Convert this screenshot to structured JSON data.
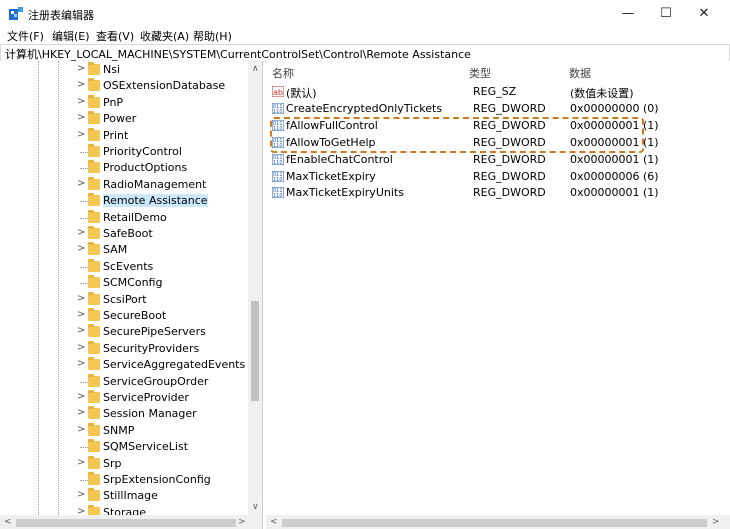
{
  "window": {
    "title": "注册表编辑器",
    "minimize_glyph": "—",
    "maximize_glyph": "☐",
    "close_glyph": "✕"
  },
  "menu": [
    "文件(F)",
    "编辑(E)",
    "查看(V)",
    "收藏夹(A)",
    "帮助(H)"
  ],
  "address": "计算机\\HKEY_LOCAL_MACHINE\\SYSTEM\\CurrentControlSet\\Control\\Remote Assistance",
  "tree": [
    {
      "label": "Nsi",
      "expandable": true
    },
    {
      "label": "OSExtensionDatabase",
      "expandable": true
    },
    {
      "label": "PnP",
      "expandable": true
    },
    {
      "label": "Power",
      "expandable": true
    },
    {
      "label": "Print",
      "expandable": true
    },
    {
      "label": "PriorityControl",
      "expandable": false
    },
    {
      "label": "ProductOptions",
      "expandable": false
    },
    {
      "label": "RadioManagement",
      "expandable": true
    },
    {
      "label": "Remote Assistance",
      "expandable": false,
      "selected": true
    },
    {
      "label": "RetailDemo",
      "expandable": false
    },
    {
      "label": "SafeBoot",
      "expandable": true
    },
    {
      "label": "SAM",
      "expandable": true
    },
    {
      "label": "ScEvents",
      "expandable": false
    },
    {
      "label": "SCMConfig",
      "expandable": false
    },
    {
      "label": "ScsiPort",
      "expandable": true
    },
    {
      "label": "SecureBoot",
      "expandable": true
    },
    {
      "label": "SecurePipeServers",
      "expandable": true
    },
    {
      "label": "SecurityProviders",
      "expandable": true
    },
    {
      "label": "ServiceAggregatedEvents",
      "expandable": true
    },
    {
      "label": "ServiceGroupOrder",
      "expandable": false
    },
    {
      "label": "ServiceProvider",
      "expandable": true
    },
    {
      "label": "Session Manager",
      "expandable": true
    },
    {
      "label": "SNMP",
      "expandable": true
    },
    {
      "label": "SQMServiceList",
      "expandable": false
    },
    {
      "label": "Srp",
      "expandable": true
    },
    {
      "label": "SrpExtensionConfig",
      "expandable": false
    },
    {
      "label": "StillImage",
      "expandable": true
    },
    {
      "label": "Storage",
      "expandable": true
    }
  ],
  "columns": {
    "name": "名称",
    "type": "类型",
    "data": "数据"
  },
  "values": [
    {
      "icon": "string-value-icon",
      "name": "(默认)",
      "type": "REG_SZ",
      "data": "(数值未设置)"
    },
    {
      "icon": "binary-value-icon",
      "name": "CreateEncryptedOnlyTickets",
      "type": "REG_DWORD",
      "data": "0x00000000 (0)"
    },
    {
      "icon": "binary-value-icon",
      "name": "fAllowFullControl",
      "type": "REG_DWORD",
      "data": "0x00000001 (1)"
    },
    {
      "icon": "binary-value-icon",
      "name": "fAllowToGetHelp",
      "type": "REG_DWORD",
      "data": "0x00000001 (1)"
    },
    {
      "icon": "binary-value-icon",
      "name": "fEnableChatControl",
      "type": "REG_DWORD",
      "data": "0x00000001 (1)"
    },
    {
      "icon": "binary-value-icon",
      "name": "MaxTicketExpiry",
      "type": "REG_DWORD",
      "data": "0x00000006 (6)"
    },
    {
      "icon": "binary-value-icon",
      "name": "MaxTicketExpiryUnits",
      "type": "REG_DWORD",
      "data": "0x00000001 (1)"
    }
  ],
  "colors": {
    "selection": "#cce8ff",
    "highlight_border": "#d07a1e",
    "folder": "#f4c752"
  }
}
